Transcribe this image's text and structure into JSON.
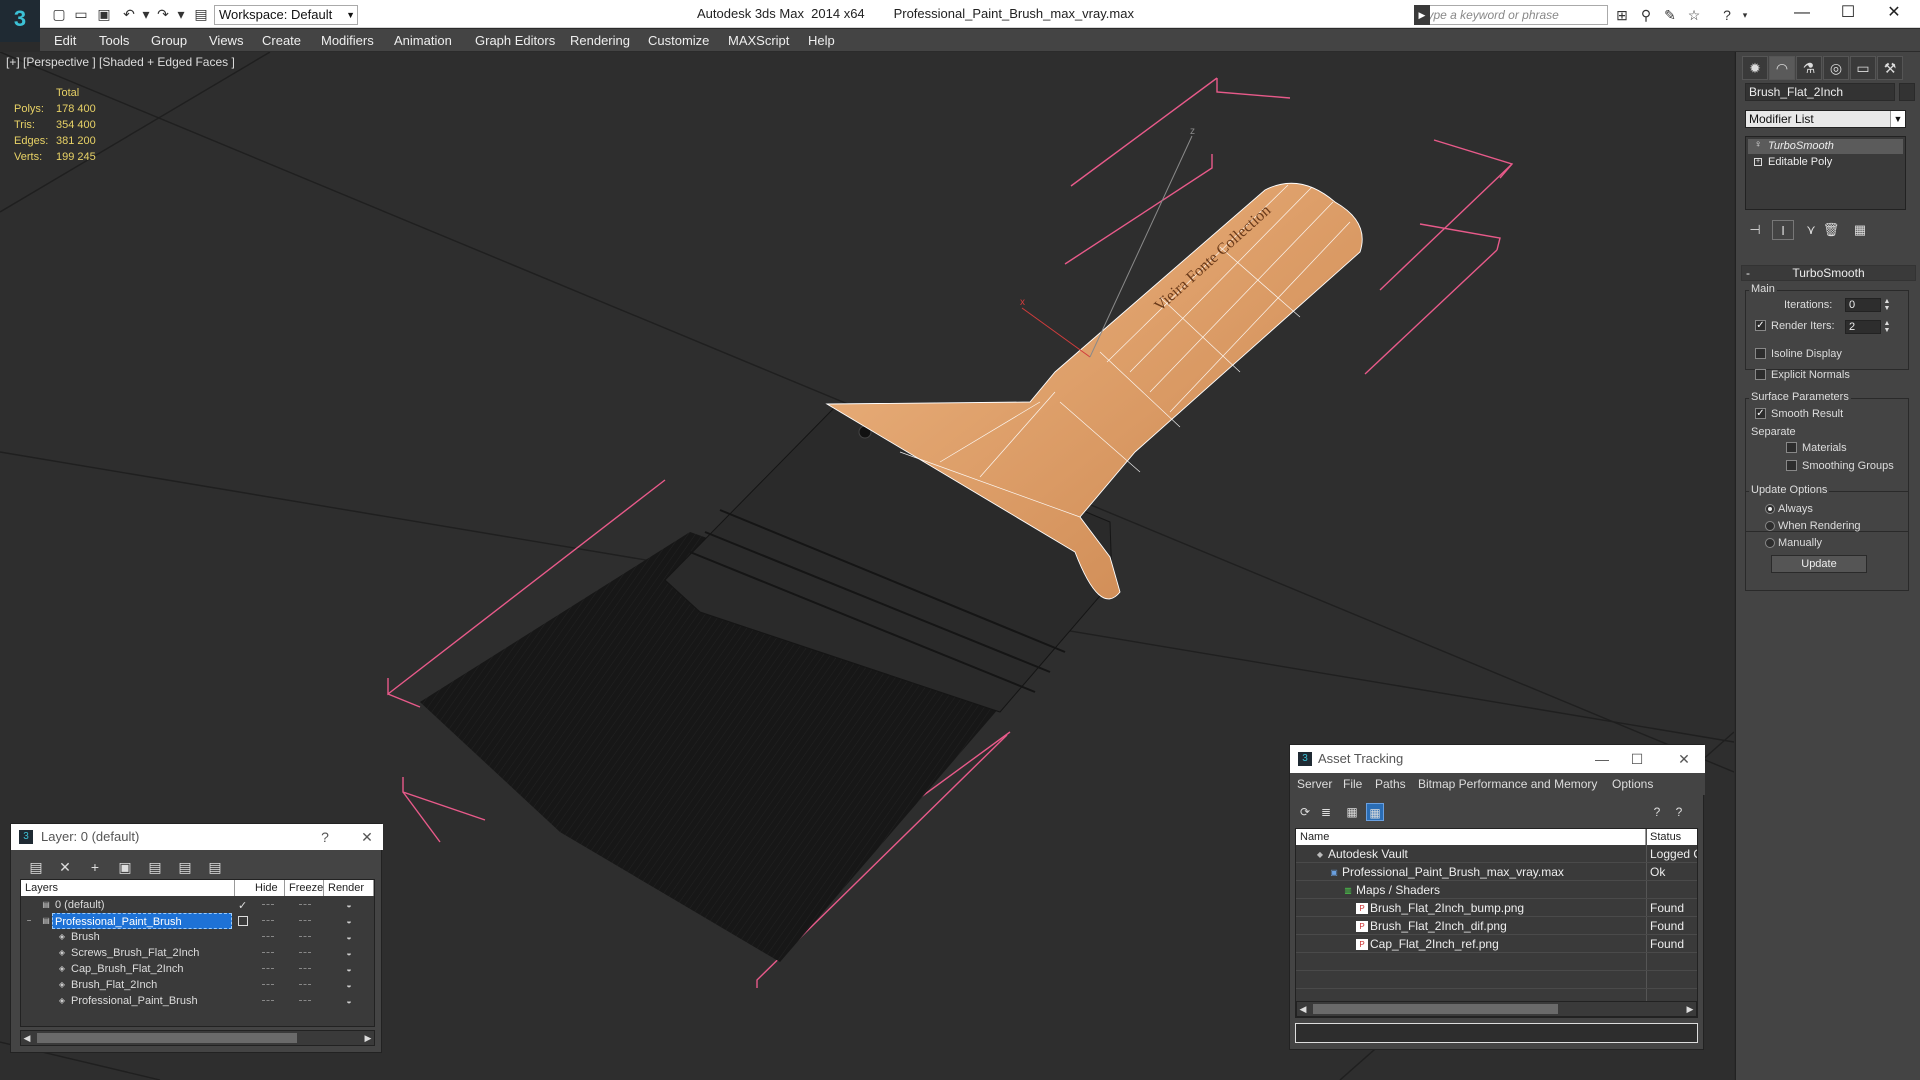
{
  "titlebar": {
    "app_name": "Autodesk 3ds Max  2014 x64",
    "file_name": "Professional_Paint_Brush_max_vray.max",
    "workspace": "Workspace: Default",
    "search_placeholder": "Type a keyword or phrase"
  },
  "menu": [
    "Edit",
    "Tools",
    "Group",
    "Views",
    "Create",
    "Modifiers",
    "Animation",
    "Graph Editors",
    "Rendering",
    "Customize",
    "MAXScript",
    "Help"
  ],
  "viewport": {
    "label": "[+] [Perspective ] [Shaded + Edged Faces ]",
    "stats": {
      "header": "Total",
      "rows": [
        {
          "key": "Polys:",
          "value": "178 400"
        },
        {
          "key": "Tris:",
          "value": "354 400"
        },
        {
          "key": "Edges:",
          "value": "381 200"
        },
        {
          "key": "Verts:",
          "value": "199 245"
        }
      ]
    },
    "handle_engraving": "Vieira Fonte Collection"
  },
  "command_panel": {
    "object_name": "Brush_Flat_2Inch",
    "modifier_list": "Modifier List",
    "stack": [
      "TurboSmooth",
      "Editable Poly"
    ],
    "rollout_title": "TurboSmooth",
    "main_group": "Main",
    "iterations_label": "Iterations:",
    "iterations_value": "0",
    "render_iters_label": "Render Iters:",
    "render_iters_value": "2",
    "render_iters_checked": true,
    "isoline_label": "Isoline Display",
    "explicit_normals_label": "Explicit Normals",
    "surface_group": "Surface Parameters",
    "smooth_result_label": "Smooth Result",
    "separate_label": "Separate",
    "materials_label": "Materials",
    "smoothing_groups_label": "Smoothing Groups",
    "update_group": "Update Options",
    "update_options": [
      "Always",
      "When Rendering",
      "Manually"
    ],
    "update_selected": "Always",
    "update_button": "Update"
  },
  "layer_window": {
    "title": "Layer: 0 (default)",
    "headers": [
      "Layers",
      "Hide",
      "Freeze",
      "Render"
    ],
    "rows": [
      {
        "name": "0 (default)",
        "level": 0
      },
      {
        "name": "Professional_Paint_Brush",
        "level": 0,
        "selected": true
      },
      {
        "name": "Brush",
        "level": 1
      },
      {
        "name": "Screws_Brush_Flat_2Inch",
        "level": 1
      },
      {
        "name": "Cap_Brush_Flat_2Inch",
        "level": 1
      },
      {
        "name": "Brush_Flat_2Inch",
        "level": 1
      },
      {
        "name": "Professional_Paint_Brush",
        "level": 1
      }
    ]
  },
  "asset_window": {
    "title": "Asset Tracking",
    "menu": [
      "Server",
      "File",
      "Paths",
      "Bitmap Performance and Memory",
      "Options"
    ],
    "headers": [
      "Name",
      "Status"
    ],
    "rows": [
      {
        "name": "Autodesk Vault",
        "status": "Logged O",
        "indent": 1
      },
      {
        "name": "Professional_Paint_Brush_max_vray.max",
        "status": "Ok",
        "indent": 2
      },
      {
        "name": "Maps / Shaders",
        "status": "",
        "indent": 3
      },
      {
        "name": "Brush_Flat_2Inch_bump.png",
        "status": "Found",
        "indent": 4
      },
      {
        "name": "Brush_Flat_2Inch_dif.png",
        "status": "Found",
        "indent": 4
      },
      {
        "name": "Cap_Flat_2Inch_ref.png",
        "status": "Found",
        "indent": 4
      }
    ]
  },
  "colors": {
    "viewport_bg": "#2e2e2e",
    "stats_text": "#e8d266",
    "wood": "#e2a06a",
    "selection_box": "#e85a8a",
    "selection_blue": "#1e72d6"
  }
}
